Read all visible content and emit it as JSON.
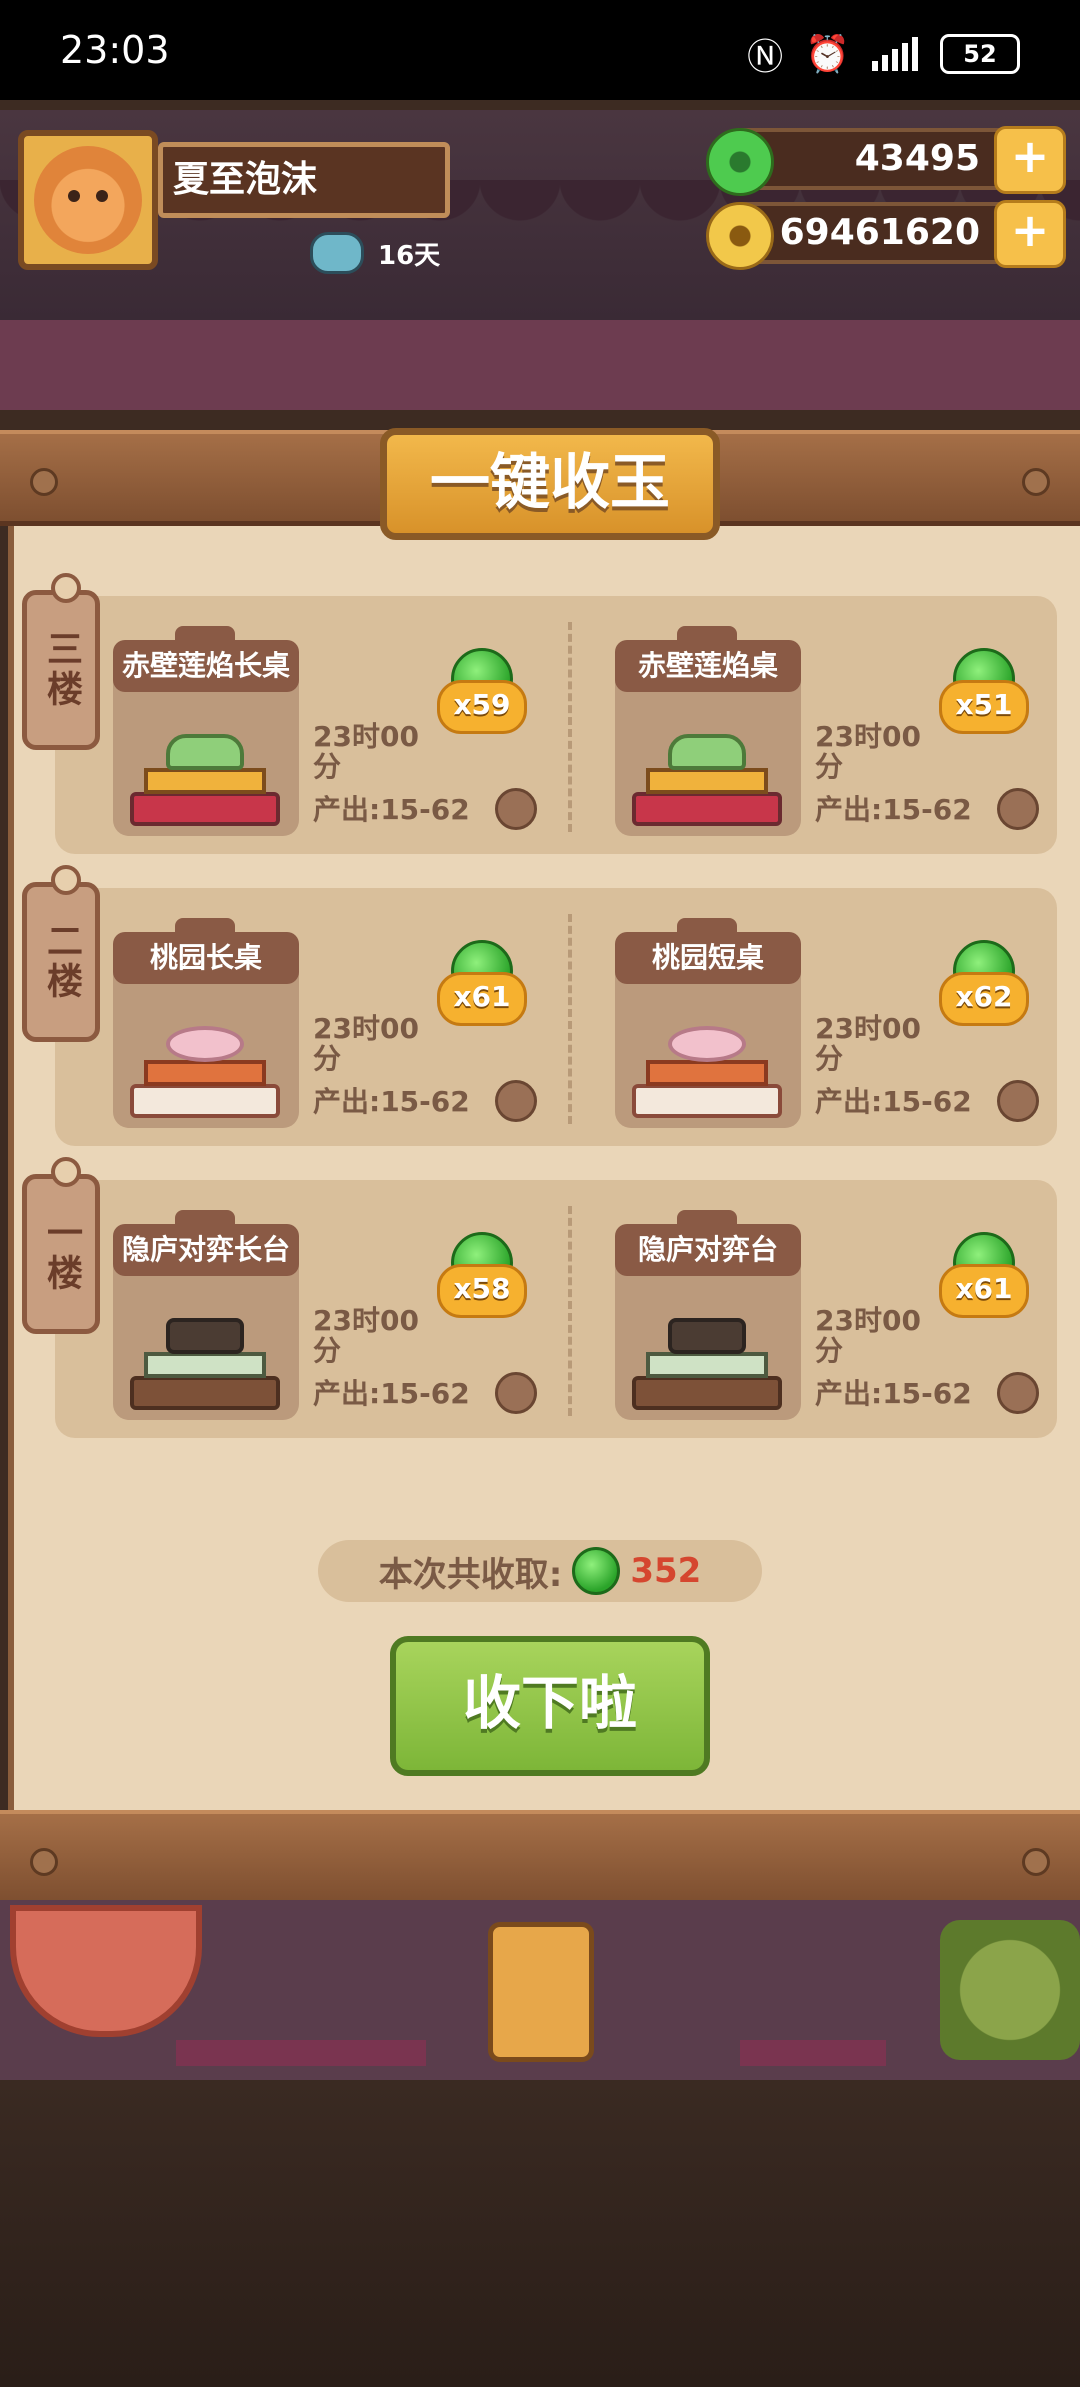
{
  "status_bar": {
    "time": "23:03",
    "battery": "52"
  },
  "player": {
    "name": "夏至泡沫",
    "days": "16天"
  },
  "currency": {
    "jade": "43495",
    "gold": "69461620",
    "plus": "+"
  },
  "panel": {
    "title": "一键收玉",
    "floors": [
      {
        "label": "三楼",
        "tables": [
          {
            "name": "赤壁莲焰长桌",
            "count": "x59",
            "time": "23时00分",
            "output": "产出:15-62"
          },
          {
            "name": "赤壁莲焰桌",
            "count": "x51",
            "time": "23时00分",
            "output": "产出:15-62"
          }
        ]
      },
      {
        "label": "二楼",
        "tables": [
          {
            "name": "桃园长桌",
            "count": "x61",
            "time": "23时00分",
            "output": "产出:15-62"
          },
          {
            "name": "桃园短桌",
            "count": "x62",
            "time": "23时00分",
            "output": "产出:15-62"
          }
        ]
      },
      {
        "label": "一楼",
        "tables": [
          {
            "name": "隐庐对弈长台",
            "count": "x58",
            "time": "23时00分",
            "output": "产出:15-62"
          },
          {
            "name": "隐庐对弈台",
            "count": "x61",
            "time": "23时00分",
            "output": "产出:15-62"
          }
        ]
      }
    ],
    "total_label": "本次共收取:",
    "total_value": "352",
    "collect_button": "收下啦"
  },
  "colors": {
    "accent_green": "#7db638",
    "jade": "#2ba42a",
    "gold": "#f2c84a",
    "total_red": "#d5462f"
  },
  "icons": [
    "jade-icon",
    "gold-coin-icon",
    "plus-icon",
    "clock-icon",
    "days-icon"
  ]
}
